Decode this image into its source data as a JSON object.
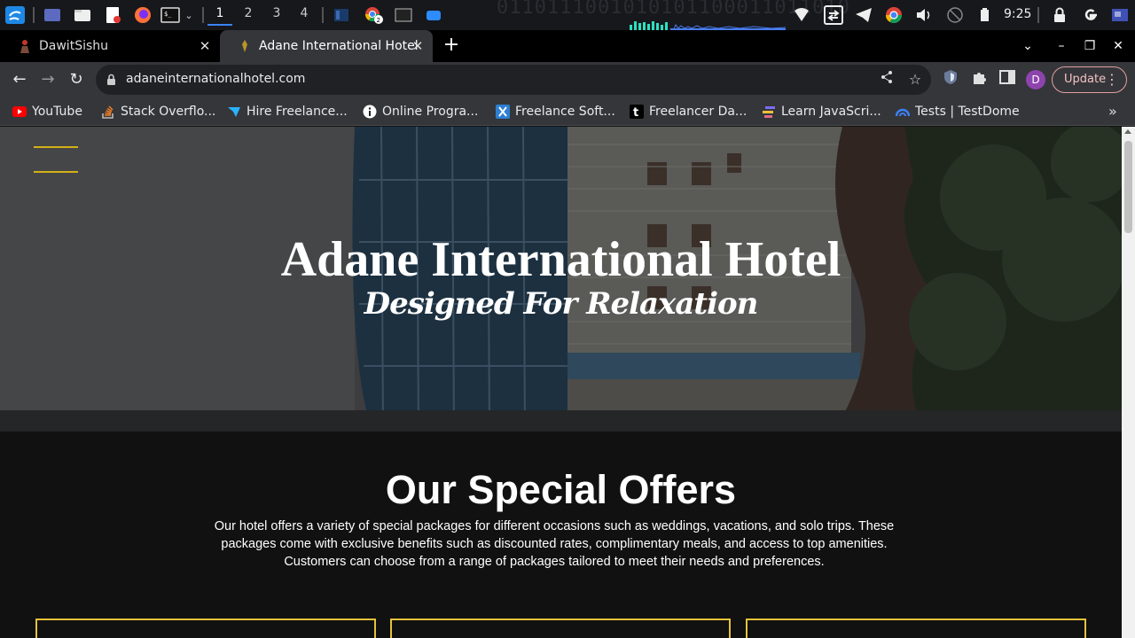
{
  "os_panel": {
    "workspaces": [
      "1",
      "2",
      "3",
      "4"
    ],
    "active_workspace": "1",
    "chrome_badge": "2",
    "clock": "9:25",
    "binary_bg": "0110111001010101100011011010"
  },
  "browser": {
    "tabs": [
      {
        "title": "DawitSishu",
        "active": false
      },
      {
        "title": "Adane International Hotel",
        "active": true
      }
    ],
    "url": "adaneinternationalhotel.com",
    "profile_initial": "D",
    "update_label": "Update",
    "bookmarks": [
      {
        "label": "YouTube",
        "icon": "youtube-icon",
        "color": "#ff0000"
      },
      {
        "label": "Stack Overflo...",
        "icon": "stackoverflow-icon",
        "color": "#f48024"
      },
      {
        "label": "Hire Freelance...",
        "icon": "freelancer-icon",
        "color": "#29b2fe"
      },
      {
        "label": "Online Progra...",
        "icon": "info-icon",
        "color": "#ffffff"
      },
      {
        "label": "Freelance Soft...",
        "icon": "x-icon",
        "color": "#2d7fd3"
      },
      {
        "label": "Freelancer Da...",
        "icon": "t-icon",
        "color": "#000000"
      },
      {
        "label": "Learn JavaScri...",
        "icon": "javascript-icon",
        "color": "#7a6df0"
      },
      {
        "label": "Tests | TestDome",
        "icon": "testdome-icon",
        "color": "#3b82f6"
      }
    ]
  },
  "page": {
    "hero_title": "Adane International Hotel",
    "hero_subtitle": "Designed For Relaxation",
    "accent_color": "#d4b017",
    "offers_title": "Our Special Offers",
    "offers_desc": "Our hotel offers a variety of special packages for different occasions such as weddings, vacations, and solo trips. These packages come with exclusive benefits such as discounted rates, complimentary meals, and access to top amenities. Customers can choose from a range of packages tailored to meet their needs and preferences."
  }
}
